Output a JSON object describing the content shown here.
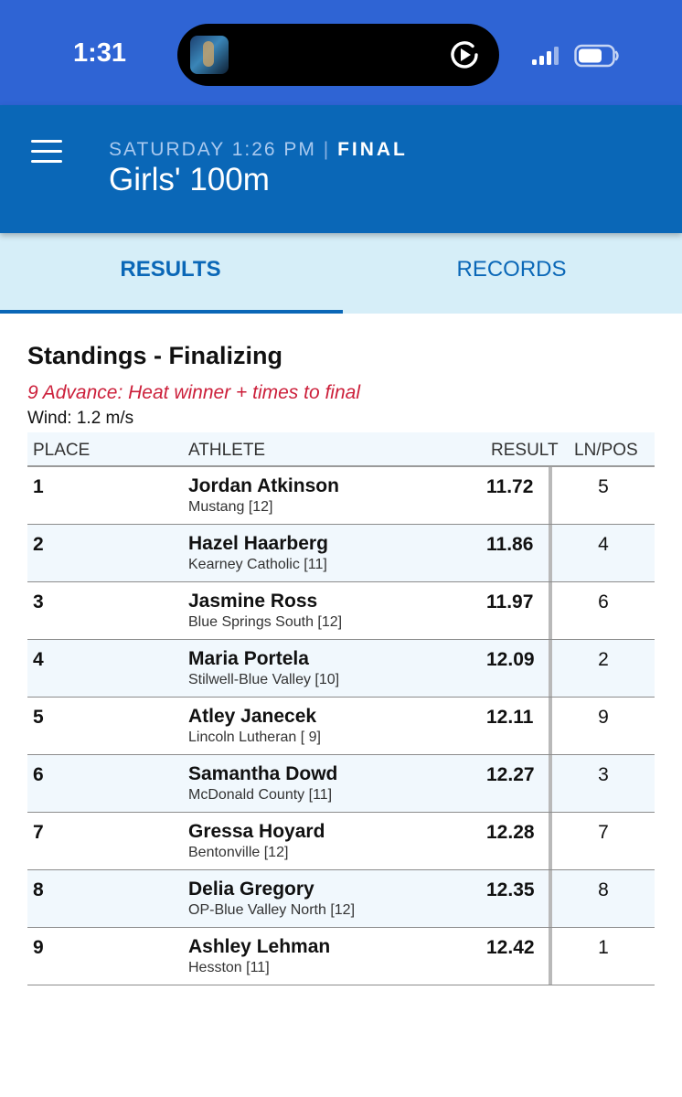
{
  "status_bar": {
    "time": "1:31",
    "media_icon": "play-circle-icon",
    "signal_icon": "cellular-signal-icon",
    "battery_icon": "battery-icon"
  },
  "header": {
    "menu_icon": "hamburger-menu-icon",
    "day_time": "SATURDAY 1:26 PM",
    "separator": "|",
    "status": "FINAL",
    "title": "Girls' 100m"
  },
  "tabs": [
    {
      "label": "RESULTS",
      "active": true
    },
    {
      "label": "RECORDS",
      "active": false
    }
  ],
  "standings": {
    "title": "Standings - Finalizing",
    "advance_note": "9 Advance: Heat winner + times to final",
    "wind": "Wind: 1.2 m/s",
    "columns": {
      "place": "PLACE",
      "athlete": "ATHLETE",
      "result": "RESULT",
      "lane": "LN/POS"
    },
    "rows": [
      {
        "place": "1",
        "name": "Jordan Atkinson",
        "team": "Mustang [12]",
        "result": "11.72",
        "lane": "5"
      },
      {
        "place": "2",
        "name": "Hazel Haarberg",
        "team": "Kearney Catholic [11]",
        "result": "11.86",
        "lane": "4"
      },
      {
        "place": "3",
        "name": "Jasmine Ross",
        "team": "Blue Springs South [12]",
        "result": "11.97",
        "lane": "6"
      },
      {
        "place": "4",
        "name": "Maria Portela",
        "team": "Stilwell-Blue Valley [10]",
        "result": "12.09",
        "lane": "2"
      },
      {
        "place": "5",
        "name": "Atley Janecek",
        "team": "Lincoln Lutheran [ 9]",
        "result": "12.11",
        "lane": "9"
      },
      {
        "place": "6",
        "name": "Samantha Dowd",
        "team": "McDonald County [11]",
        "result": "12.27",
        "lane": "3"
      },
      {
        "place": "7",
        "name": "Gressa Hoyard",
        "team": "Bentonville [12]",
        "result": "12.28",
        "lane": "7"
      },
      {
        "place": "8",
        "name": "Delia Gregory",
        "team": "OP-Blue Valley North [12]",
        "result": "12.35",
        "lane": "8"
      },
      {
        "place": "9",
        "name": "Ashley Lehman",
        "team": "Hesston [11]",
        "result": "12.42",
        "lane": "1"
      }
    ]
  },
  "colors": {
    "status_bar": "#2f64d4",
    "app_bar": "#0a67b7",
    "tab_bar": "#d6eef8",
    "advance_text": "#cc1f3a"
  }
}
